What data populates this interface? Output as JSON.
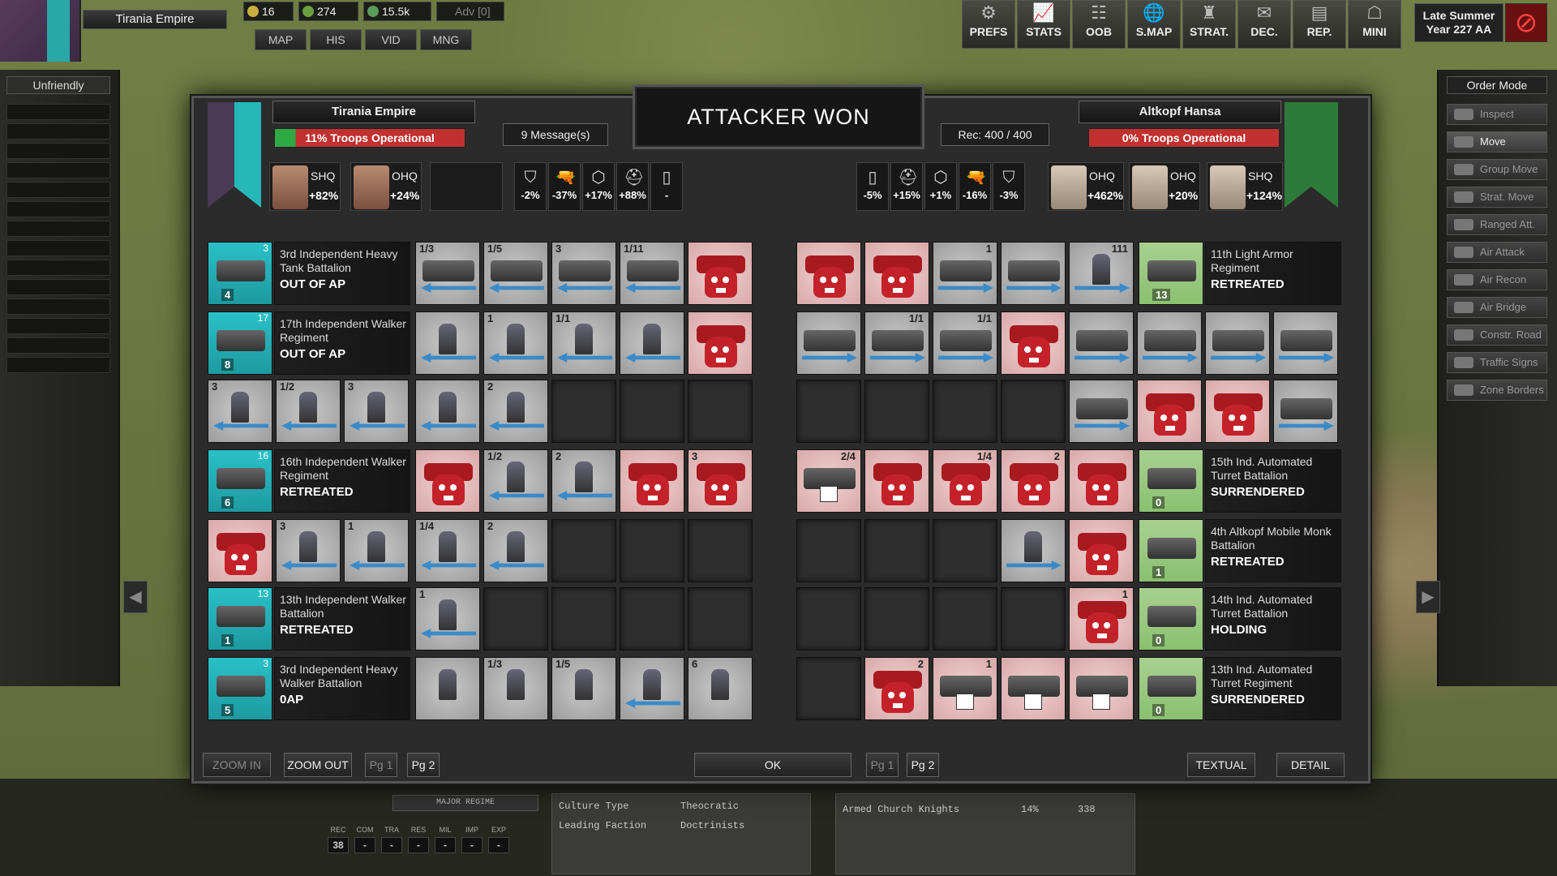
{
  "top": {
    "nation": "Tirania Empire",
    "resources": [
      {
        "v": "16",
        "c": "#c8b040"
      },
      {
        "v": "274",
        "c": "#6aa040"
      },
      {
        "v": "15.5k",
        "c": "#5a9a5a"
      },
      {
        "v": "Adv [0]",
        "c": "#888"
      }
    ],
    "tabs": [
      "MAP",
      "HIS",
      "VID",
      "MNG"
    ],
    "icons": [
      {
        "label": "PREFS",
        "glyph": "⚙"
      },
      {
        "label": "STATS",
        "glyph": "📈"
      },
      {
        "label": "OOB",
        "glyph": "☷"
      },
      {
        "label": "S.MAP",
        "glyph": "🌐"
      },
      {
        "label": "STRAT.",
        "glyph": "♜"
      },
      {
        "label": "DEC.",
        "glyph": "✉"
      },
      {
        "label": "REP.",
        "glyph": "▤"
      },
      {
        "label": "MINI",
        "glyph": "☖"
      }
    ],
    "season_line1": "Late Summer",
    "season_line2": "Year 227 AA",
    "no_glyph": "⊘"
  },
  "left_panel": {
    "status": "Unfriendly"
  },
  "right_panel": {
    "title": "Order Mode",
    "orders": [
      {
        "label": "Inspect",
        "active": false
      },
      {
        "label": "Move",
        "active": true
      },
      {
        "label": "Group Move",
        "active": false
      },
      {
        "label": "Strat. Move",
        "active": false
      },
      {
        "label": "Ranged Att.",
        "active": false
      },
      {
        "label": "Air Attack",
        "active": false
      },
      {
        "label": "Air Recon",
        "active": false
      },
      {
        "label": "Air Bridge",
        "active": false
      },
      {
        "label": "Constr. Road",
        "active": false
      },
      {
        "label": "Traffic Signs",
        "active": false
      },
      {
        "label": "Zone Borders",
        "active": false
      }
    ]
  },
  "battle": {
    "result": "ATTACKER WON",
    "attacker": {
      "name": "Tirania Empire",
      "troops": "11% Troops Operational",
      "troops_pct": 11,
      "messages": "9 Message(s)",
      "hq": [
        {
          "lbl": "SHQ",
          "pct": "+82%"
        },
        {
          "lbl": "OHQ",
          "pct": "+24%"
        }
      ],
      "mods": [
        {
          "g": "⛉",
          "v": "-2%"
        },
        {
          "g": "🔫",
          "v": "-37%"
        },
        {
          "g": "⬡",
          "v": "+17%"
        },
        {
          "g": "⛑",
          "v": "+88%"
        },
        {
          "g": "▯",
          "v": "-"
        }
      ]
    },
    "defender": {
      "name": "Altkopf Hansa",
      "troops": "0% Troops Operational",
      "troops_pct": 0,
      "rec": "Rec: 400 / 400",
      "hq": [
        {
          "lbl": "OHQ",
          "pct": "+462%"
        },
        {
          "lbl": "OHQ",
          "pct": "+20%"
        },
        {
          "lbl": "SHQ",
          "pct": "+124%"
        }
      ],
      "mods": [
        {
          "g": "▯",
          "v": "-5%"
        },
        {
          "g": "⛑",
          "v": "+15%"
        },
        {
          "g": "⬡",
          "v": "+1%"
        },
        {
          "g": "🔫",
          "v": "-16%"
        },
        {
          "g": "⛉",
          "v": "-3%"
        }
      ]
    }
  },
  "attacker_units": [
    {
      "name": "3rd Independent Heavy Tank Battalion",
      "status": "OUT OF AP",
      "count": "4",
      "tl": "3"
    },
    {
      "name": "17th Independent Walker Regiment",
      "status": "OUT OF AP",
      "count": "8",
      "tl": "17"
    },
    null,
    {
      "name": "16th Independent Walker Regiment",
      "status": "RETREATED",
      "count": "6",
      "tl": "16"
    },
    null,
    {
      "name": "13th Independent Walker Battalion",
      "status": "RETREATED",
      "count": "1",
      "tl": "13"
    },
    {
      "name": "3rd Independent Heavy Walker Battalion",
      "status": "0AP",
      "count": "5",
      "tl": "3"
    }
  ],
  "defender_units": [
    {
      "name": "11th Light Armor Regiment",
      "status": "RETREATED",
      "count": "13"
    },
    null,
    null,
    {
      "name": "15th Ind. Automated Turret Battalion",
      "status": "SURRENDERED",
      "count": "0"
    },
    {
      "name": "4th Altkopf Mobile Monk Battalion",
      "status": "RETREATED",
      "count": "1"
    },
    {
      "name": "14th Ind. Automated Turret Battalion",
      "status": "HOLDING",
      "count": "0"
    },
    {
      "name": "13th Ind. Automated Turret Regiment",
      "status": "SURRENDERED",
      "count": "0"
    }
  ],
  "att_rows": [
    [
      {
        "k": "veh",
        "d": "L",
        "t": "1/3"
      },
      {
        "k": "veh",
        "d": "L",
        "t": "1/5"
      },
      {
        "k": "veh",
        "d": "L",
        "t": "3"
      },
      {
        "k": "veh",
        "d": "L",
        "t": "1/11"
      },
      {
        "k": "skull"
      }
    ],
    [
      {
        "k": "inf",
        "d": "L"
      },
      {
        "k": "inf",
        "d": "L",
        "t": "1"
      },
      {
        "k": "inf",
        "d": "L",
        "t": "1/1"
      },
      {
        "k": "inf",
        "d": "L"
      },
      {
        "k": "skull"
      }
    ],
    [
      {
        "k": "inf",
        "d": "L",
        "t": "3"
      },
      {
        "k": "inf",
        "d": "L",
        "t": "1/2"
      },
      {
        "k": "inf",
        "d": "L",
        "t": "3"
      },
      {
        "k": "inf",
        "d": "L"
      },
      {
        "k": "inf",
        "d": "L",
        "t": "2"
      },
      {
        "k": "e"
      },
      {
        "k": "e"
      },
      {
        "k": "e"
      }
    ],
    [
      {
        "k": "skull"
      },
      {
        "k": "inf",
        "d": "L",
        "t": "1/2"
      },
      {
        "k": "inf",
        "d": "L",
        "t": "2"
      },
      {
        "k": "skull"
      },
      {
        "k": "skull",
        "t": "3"
      }
    ],
    [
      {
        "k": "skull"
      },
      {
        "k": "inf",
        "d": "L",
        "t": "3"
      },
      {
        "k": "inf",
        "d": "L",
        "t": "1"
      },
      {
        "k": "inf",
        "d": "L",
        "t": "1/4"
      },
      {
        "k": "inf",
        "d": "L",
        "t": "2"
      },
      {
        "k": "e"
      },
      {
        "k": "e"
      },
      {
        "k": "e"
      }
    ],
    [
      {
        "k": "inf",
        "d": "L",
        "t": "1"
      },
      {
        "k": "e"
      },
      {
        "k": "e"
      },
      {
        "k": "e"
      },
      {
        "k": "e"
      }
    ],
    [
      {
        "k": "inf"
      },
      {
        "k": "inf",
        "t": "1/3"
      },
      {
        "k": "inf",
        "t": "1/5"
      },
      {
        "k": "inf",
        "d": "L"
      },
      {
        "k": "inf",
        "t": "6"
      }
    ]
  ],
  "def_rows": [
    [
      {
        "k": "skull"
      },
      {
        "k": "skull"
      },
      {
        "k": "veh",
        "d": "R",
        "t": "1"
      },
      {
        "k": "veh",
        "d": "R"
      },
      {
        "k": "inf",
        "d": "R",
        "t": "111"
      }
    ],
    [
      {
        "k": "veh",
        "d": "R"
      },
      {
        "k": "veh",
        "d": "R",
        "t": "1/1"
      },
      {
        "k": "veh",
        "d": "R",
        "t": "1/1"
      },
      {
        "k": "skull"
      },
      {
        "k": "veh",
        "d": "R"
      },
      {
        "k": "veh",
        "d": "R"
      },
      {
        "k": "veh",
        "d": "R"
      },
      {
        "k": "veh",
        "d": "R"
      }
    ],
    [
      {
        "k": "e"
      },
      {
        "k": "e"
      },
      {
        "k": "e"
      },
      {
        "k": "e"
      },
      {
        "k": "veh",
        "d": "R"
      },
      {
        "k": "skull"
      },
      {
        "k": "skull"
      },
      {
        "k": "veh",
        "d": "R"
      }
    ],
    [
      {
        "k": "flag",
        "t": "2/4"
      },
      {
        "k": "skull"
      },
      {
        "k": "skull",
        "t": "1/4"
      },
      {
        "k": "skull",
        "t": "2"
      },
      {
        "k": "skull"
      }
    ],
    [
      {
        "k": "e"
      },
      {
        "k": "e"
      },
      {
        "k": "e"
      },
      {
        "k": "inf",
        "d": "R"
      },
      {
        "k": "skull"
      }
    ],
    [
      {
        "k": "e"
      },
      {
        "k": "e"
      },
      {
        "k": "e"
      },
      {
        "k": "e"
      },
      {
        "k": "skull",
        "t": "1"
      }
    ],
    [
      {
        "k": "e"
      },
      {
        "k": "skull",
        "t": "2"
      },
      {
        "k": "flag",
        "t": "1"
      },
      {
        "k": "flag"
      },
      {
        "k": "flag"
      }
    ]
  ],
  "footer": {
    "zoom_in": "ZOOM IN",
    "zoom_out": "ZOOM OUT",
    "pg1": "Pg 1",
    "pg2": "Pg 2",
    "ok": "OK",
    "textual": "TEXTUAL",
    "detail": "DETAIL"
  },
  "bottom": {
    "regime": "MAJOR REGIME",
    "stats": [
      {
        "l": "REC",
        "v": "38"
      },
      {
        "l": "COM",
        "v": "-"
      },
      {
        "l": "TRA",
        "v": "-"
      },
      {
        "l": "RES",
        "v": "-"
      },
      {
        "l": "MIL",
        "v": "-"
      },
      {
        "l": "IMP",
        "v": "-"
      },
      {
        "l": "EXP",
        "v": "-"
      }
    ],
    "rows": [
      {
        "k": "Culture Type",
        "v": "Theocratic"
      },
      {
        "k": "Leading Faction",
        "v": "Doctrinists"
      }
    ],
    "faction": {
      "name": "Armed Church Knights",
      "pct": "14%",
      "num": "338"
    }
  }
}
